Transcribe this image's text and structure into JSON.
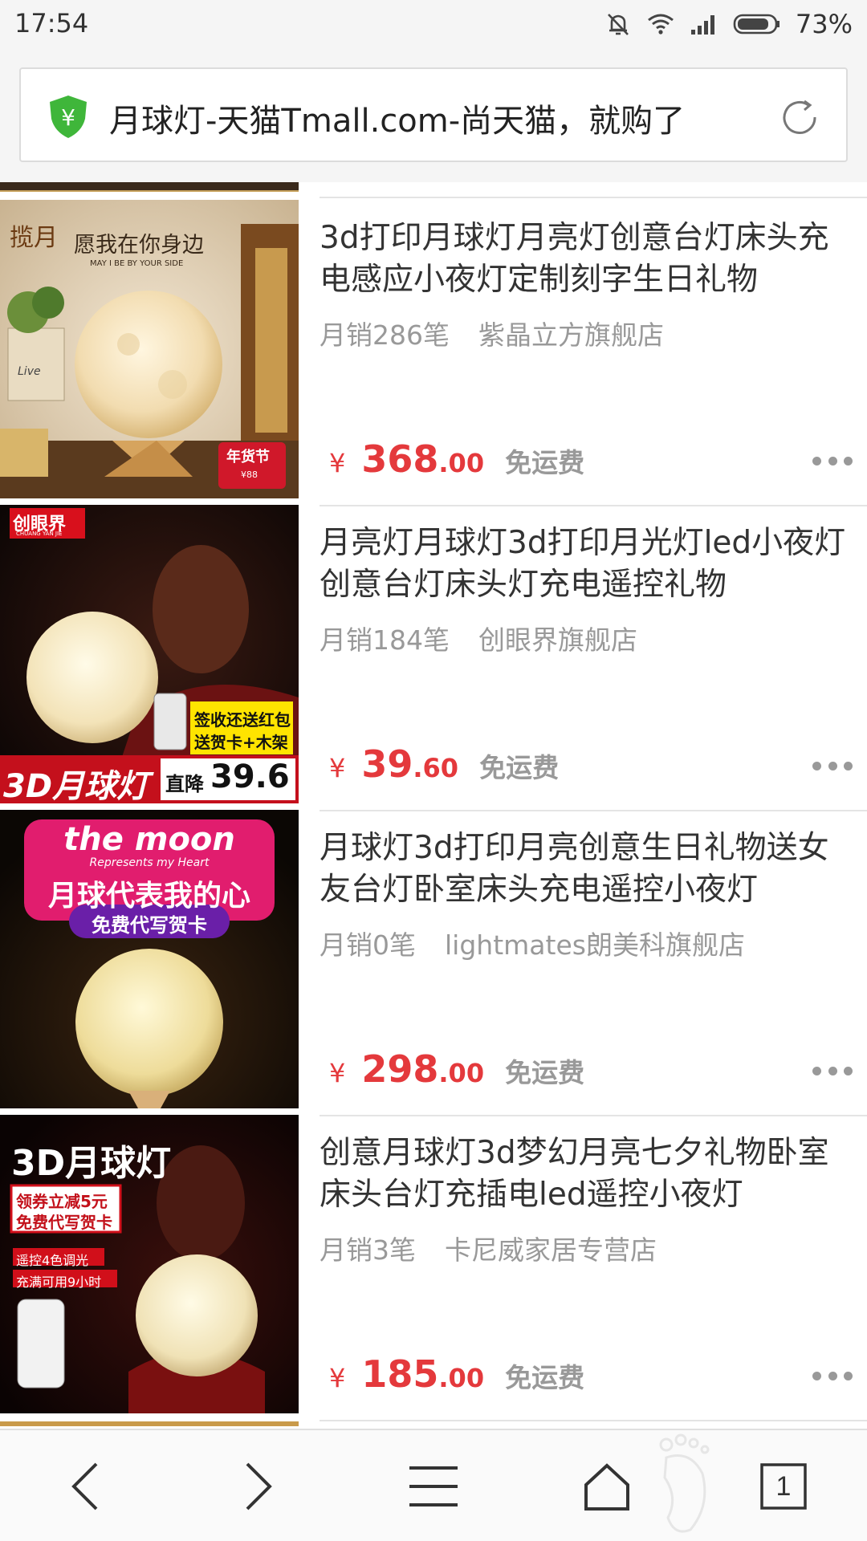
{
  "status": {
    "time": "17:54",
    "battery": "73%"
  },
  "browser": {
    "page_title": "月球灯-天猫Tmall.com-尚天猫，就购了",
    "tab_count": "1"
  },
  "products": [
    {
      "title": "3d打印月球灯月亮灯创意台灯床头充电感应小夜灯定制刻字生日礼物",
      "sales": "月销286笔",
      "shop": "紫晶立方旗舰店",
      "currency": "¥",
      "price_int": "368",
      "price_dec": ".00",
      "shipping": "免运费",
      "image": {
        "logo": "揽月",
        "headline": "愿我在你身边",
        "subline": "MAY I BE BY YOUR SIDE",
        "badge": "年货节",
        "badge_price": "¥88",
        "mug_text": "Live"
      }
    },
    {
      "title": "月亮灯月球灯3d打印月光灯led小夜灯创意台灯床头灯充电遥控礼物",
      "sales": "月销184笔",
      "shop": "创眼界旗舰店",
      "currency": "¥",
      "price_int": "39",
      "price_dec": ".60",
      "shipping": "免运费",
      "image": {
        "logo": "创眼界",
        "logo_sub": "CHUANG YAN JIE",
        "promo1": "签收还送红包",
        "promo2": "送贺卡+木架",
        "banner": "3D月球灯",
        "banner_price_label": "直降",
        "banner_price": "39.6"
      }
    },
    {
      "title": "月球灯3d打印月亮创意生日礼物送女友台灯卧室床头充电遥控小夜灯",
      "sales": "月销0笔",
      "shop": "lightmates朗美科旗舰店",
      "currency": "¥",
      "price_int": "298",
      "price_dec": ".00",
      "shipping": "免运费",
      "image": {
        "line1": "the moon",
        "line2": "Represents my Heart",
        "line3": "月球代表我的心",
        "pill": "免费代写贺卡"
      }
    },
    {
      "title": "创意月球灯3d梦幻月亮七夕礼物卧室床头台灯充插电led遥控小夜灯",
      "sales": "月销3笔",
      "shop": "卡尼威家居专营店",
      "currency": "¥",
      "price_int": "185",
      "price_dec": ".00",
      "shipping": "免运费",
      "image": {
        "headline": "3D月球灯",
        "promo1": "领券立减5元",
        "promo2": "免费代写贺卡",
        "tag1": "遥控4色调光",
        "tag2": "充满可用9小时"
      }
    }
  ],
  "colors": {
    "price": "#e4393c",
    "muted": "#999999",
    "shield": "#3fb63a"
  }
}
